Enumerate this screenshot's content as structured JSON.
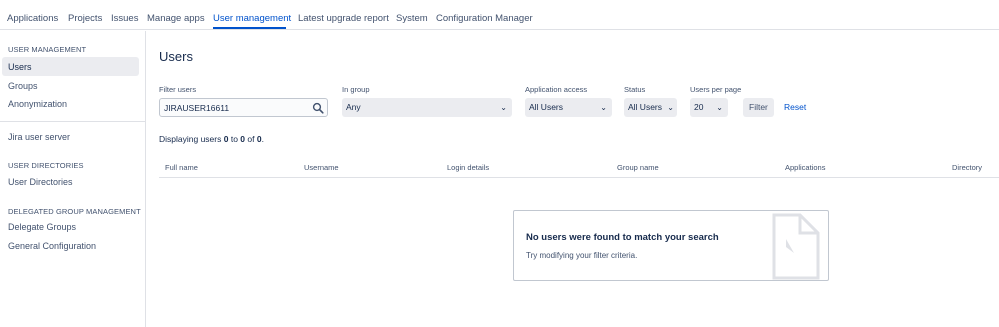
{
  "topnav": {
    "tabs": [
      {
        "label": "Applications"
      },
      {
        "label": "Projects"
      },
      {
        "label": "Issues"
      },
      {
        "label": "Manage apps"
      },
      {
        "label": "User management",
        "active": true
      },
      {
        "label": "Latest upgrade report"
      },
      {
        "label": "System"
      },
      {
        "label": "Configuration Manager"
      }
    ]
  },
  "sidebar": {
    "section_user_management": "USER MANAGEMENT",
    "item_users": "Users",
    "item_groups": "Groups",
    "item_anonymization": "Anonymization",
    "item_jira_user_server": "Jira user server",
    "section_user_directories": "USER DIRECTORIES",
    "item_user_directories": "User Directories",
    "section_delegated": "DELEGATED GROUP MANAGEMENT",
    "item_delegate_groups": "Delegate Groups",
    "item_general_configuration": "General Configuration"
  },
  "main": {
    "title": "Users",
    "filters": {
      "filter_users_label": "Filter users",
      "filter_users_value": "JIRAUSER16611",
      "in_group_label": "In group",
      "in_group_value": "Any",
      "app_access_label": "Application access",
      "app_access_value": "All Users",
      "status_label": "Status",
      "status_value": "All Users",
      "per_page_label": "Users per page",
      "per_page_value": "20",
      "filter_button": "Filter",
      "reset_link": "Reset"
    },
    "display": {
      "prefix": "Displaying users ",
      "from": "0",
      "to_word": " to ",
      "to": "0",
      "of_word": " of ",
      "total": "0",
      "suffix": "."
    },
    "table_headers": {
      "full_name": "Full name",
      "username": "Username",
      "login_details": "Login details",
      "group_name": "Group name",
      "applications": "Applications",
      "directory": "Directory"
    },
    "empty_state": {
      "title": "No users were found to match your search",
      "subtitle": "Try modifying your filter criteria."
    }
  },
  "colors": {
    "accent": "#0052cc",
    "text": "#172b4d",
    "subtle": "#42526e",
    "border": "#dfe1e6"
  }
}
